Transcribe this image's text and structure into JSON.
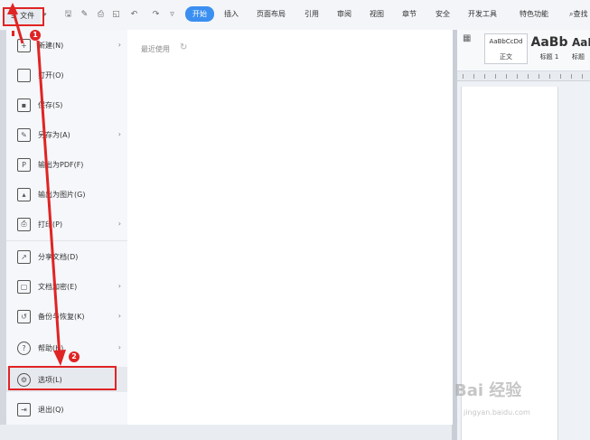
{
  "toolbar": {
    "file_label": "文件",
    "tabs": [
      {
        "label": "开始"
      },
      {
        "label": "插入"
      },
      {
        "label": "页面布局"
      },
      {
        "label": "引用"
      },
      {
        "label": "审阅"
      },
      {
        "label": "视图"
      },
      {
        "label": "章节"
      },
      {
        "label": "安全"
      },
      {
        "label": "开发工具"
      },
      {
        "label": "特色功能"
      }
    ],
    "search_label": "查找"
  },
  "styles": [
    {
      "sample": "AaBbCcDd",
      "label": "正文"
    },
    {
      "sample": "AaBb",
      "label": "标题 1"
    },
    {
      "sample": "AaB",
      "label": "标题"
    }
  ],
  "menu": {
    "items": [
      {
        "label": "新建(N)",
        "icon": "new-doc-icon"
      },
      {
        "label": "打开(O)",
        "icon": "folder-icon"
      },
      {
        "label": "保存(S)",
        "icon": "save-icon"
      },
      {
        "label": "另存为(A)",
        "icon": "save-as-icon"
      },
      {
        "label": "输出为PDF(F)",
        "icon": "pdf-icon"
      },
      {
        "label": "输出为图片(G)",
        "icon": "image-icon"
      },
      {
        "label": "打印(P)",
        "icon": "print-icon"
      },
      {
        "label": "分享文档(D)",
        "icon": "share-icon"
      },
      {
        "label": "文档加密(E)",
        "icon": "lock-icon"
      },
      {
        "label": "备份与恢复(K)",
        "icon": "backup-icon"
      },
      {
        "label": "帮助(H)",
        "icon": "help-icon"
      },
      {
        "label": "选项(L)",
        "icon": "gear-icon"
      },
      {
        "label": "退出(Q)",
        "icon": "exit-icon"
      }
    ]
  },
  "recent": {
    "title": "最近使用"
  },
  "annotations": {
    "step1": "1",
    "step2": "2"
  },
  "watermark": {
    "logo": "Bai 经验",
    "url": "jingyan.baidu.com"
  },
  "colors": {
    "accent": "#3b8ff0",
    "annotation_red": "#e02424"
  }
}
